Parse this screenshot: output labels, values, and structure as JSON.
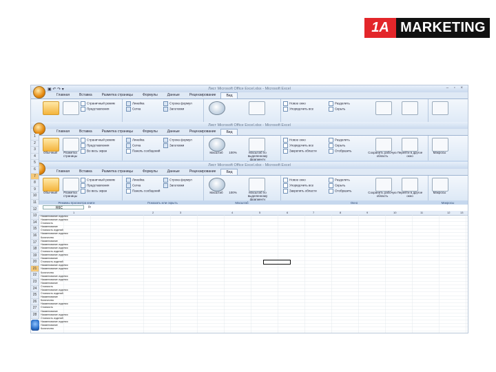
{
  "logo": {
    "number": "1A",
    "word": "MARKETING"
  },
  "excel": {
    "window_title": "Лист Microsoft Office Excel.xlsx - Microsoft Excel",
    "tabs": [
      "Главная",
      "Вставка",
      "Разметка страницы",
      "Формулы",
      "Данные",
      "Рецензирование",
      "Вид"
    ],
    "active_tab": "Вид",
    "groups": {
      "views": {
        "label": "Режимы просмотра книги",
        "normal": "Обычный",
        "page_layout": "Разметка страницы",
        "page_break": "Страничный режим",
        "custom": "Представления",
        "full_screen": "Во весь экран"
      },
      "show": {
        "label": "Показать или скрыть",
        "ruler": "Линейка",
        "grid": "Сетка",
        "messages": "Панель сообщений",
        "formula_bar": "Строка формул",
        "headings": "Заголовки"
      },
      "zoom": {
        "label": "Масштаб",
        "zoom": "Масштаб",
        "hundred": "100%",
        "fit": "Масштаб по выделенному фрагменту"
      },
      "window": {
        "label": "Окно",
        "new": "Новое окно",
        "arrange": "Упорядочить все",
        "freeze": "Закрепить области",
        "split": "Разделить",
        "hide": "Скрыть",
        "unhide": "Отобразить",
        "save_ws": "Сохранить рабочую область",
        "switch": "Перейти в другое окно"
      },
      "macros": {
        "label": "Макросы",
        "macros": "Макросы"
      }
    },
    "namebox": "R6C",
    "fx": "fx",
    "columns": [
      "1",
      "2",
      "3",
      "4",
      "5",
      "6",
      "7",
      "8",
      "9",
      "10",
      "11",
      "12",
      "13"
    ],
    "rows": [
      "1",
      "2",
      "3",
      "4",
      "5",
      "6",
      "7",
      "8",
      "9",
      "10",
      "11",
      "12",
      "13",
      "14",
      "15",
      "16",
      "17",
      "18",
      "19",
      "20",
      "21",
      "22",
      "23",
      "24",
      "25",
      "26",
      "27",
      "28"
    ],
    "cells": [
      "Наименование изделия",
      "Наименование изделия",
      "Стоимость",
      "Наименование",
      "Стоимость изделий",
      "Наименование изделия",
      "Количество",
      "Наименование",
      "Наименование изделия",
      "Наименование изделия",
      "Стоимость изделий",
      "Наименование изделия",
      "Наименование",
      "Стоимость изделий",
      "Наименование изделия",
      "Наименование изделия",
      "Количество",
      "Наименование изделия",
      "Наименование изделия",
      "Наименование",
      "Стоимость",
      "Наименование изделия",
      "Стоимость изделий",
      "Наименование",
      "Количество",
      "Наименование изделия",
      "Стоимость",
      "Наименование",
      "Наименование изделия",
      "Стоимость изделий",
      "Наименование изделия",
      "Наименование",
      "Количество"
    ]
  },
  "colors": {
    "logo_red": "#e3262a",
    "logo_black": "#111111",
    "ribbon": "#dfe9f5"
  }
}
